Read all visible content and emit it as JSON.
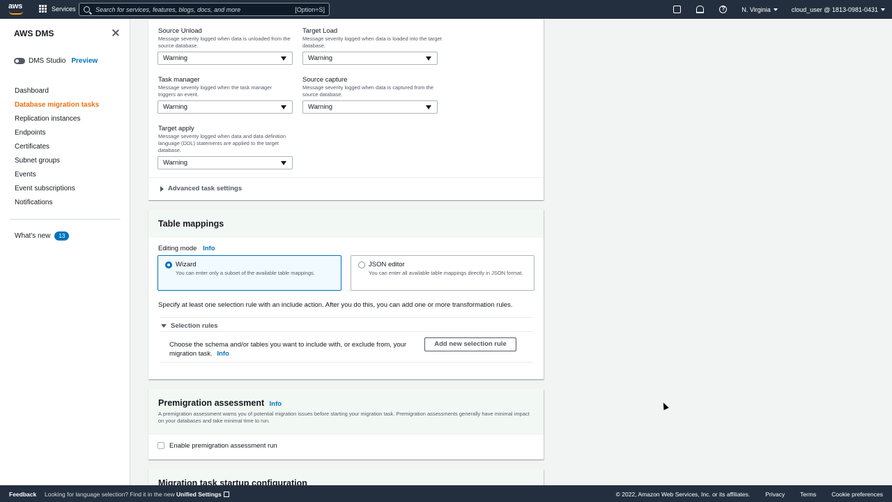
{
  "topnav": {
    "logo_text": "aws",
    "services_label": "Services",
    "search_placeholder": "Search for services, features, blogs, docs, and more",
    "search_shortcut": "[Option+S]",
    "region": "N. Virginia",
    "account": "cloud_user @ 1813-0981-0431"
  },
  "sidebar": {
    "title": "AWS DMS",
    "studio_label": "DMS Studio",
    "studio_preview": "Preview",
    "items": [
      {
        "label": "Dashboard"
      },
      {
        "label": "Database migration tasks",
        "active": true
      },
      {
        "label": "Replication instances"
      },
      {
        "label": "Endpoints"
      },
      {
        "label": "Certificates"
      },
      {
        "label": "Subnet groups"
      },
      {
        "label": "Events"
      },
      {
        "label": "Event subscriptions"
      },
      {
        "label": "Notifications"
      }
    ],
    "whats_new": "What's new",
    "whats_new_count": "13"
  },
  "logging": {
    "source_unload": {
      "label": "Source Unload",
      "desc": "Message severity logged when data is unloaded from the source database.",
      "value": "Warning"
    },
    "target_load": {
      "label": "Target Load",
      "desc": "Message severity logged when data is loaded into the target database.",
      "value": "Warning"
    },
    "task_manager": {
      "label": "Task manager",
      "desc": "Message severity logged when the task manager triggers an event.",
      "value": "Warning"
    },
    "source_capture": {
      "label": "Source capture",
      "desc": "Message severity logged when data is captured from the source database.",
      "value": "Warning"
    },
    "target_apply": {
      "label": "Target apply",
      "desc": "Message severity logged when data and data definition language (DDL) statements are applied to the target database.",
      "value": "Warning"
    },
    "advanced": "Advanced task settings"
  },
  "mappings": {
    "title": "Table mappings",
    "editing_mode": "Editing mode",
    "info": "Info",
    "wizard_label": "Wizard",
    "wizard_desc": "You can enter only a subset of the available table mappings.",
    "json_label": "JSON editor",
    "json_desc": "You can enter all available table mappings directly in JSON format.",
    "hint": "Specify at least one selection rule with an include action. After you do this, you can add one or more transformation rules.",
    "selection_rules": "Selection rules",
    "rules_desc": "Choose the schema and/or tables you want to include with, or exclude from, your migration task.",
    "add_rule": "Add new selection rule"
  },
  "premig": {
    "title": "Premigration assessment",
    "info": "Info",
    "desc": "A premigration assessment warns you of potential migration issues before starting your migration task. Premigration assessments generally have minimal impact on your databases and take minimal time to run.",
    "checkbox_label": "Enable premigration assessment run"
  },
  "startup": {
    "title": "Migration task startup configuration"
  },
  "footer": {
    "feedback": "Feedback",
    "lang_text": "Looking for language selection? Find it in the new",
    "lang_link": "Unified Settings",
    "copyright": "© 2022, Amazon Web Services, Inc. or its affiliates.",
    "privacy": "Privacy",
    "terms": "Terms",
    "cookies": "Cookie preferences"
  }
}
